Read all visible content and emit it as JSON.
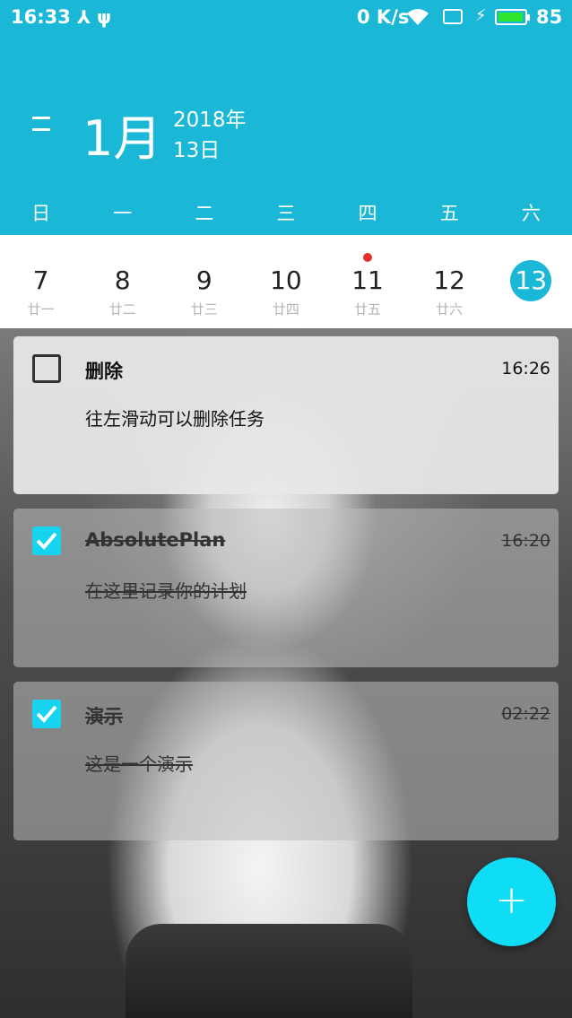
{
  "status_bar": {
    "time": "16:33",
    "left_icons": "⅄ ψ",
    "net_speed": "0 K/s",
    "battery_percent": "85",
    "battery_level": 0.85
  },
  "header": {
    "month": "1月",
    "year": "2018年",
    "day": "13日",
    "color": "#1ab8d6"
  },
  "weekdays": [
    "日",
    "一",
    "二",
    "三",
    "四",
    "五",
    "六"
  ],
  "dates": [
    {
      "num": "7",
      "lunar": "廿一"
    },
    {
      "num": "8",
      "lunar": "廿二"
    },
    {
      "num": "9",
      "lunar": "廿三"
    },
    {
      "num": "10",
      "lunar": "廿四"
    },
    {
      "num": "11",
      "lunar": "廿五"
    },
    {
      "num": "12",
      "lunar": "廿六"
    },
    {
      "num": "13",
      "lunar": ""
    }
  ],
  "tasks": [
    {
      "title": "删除",
      "time": "16:26",
      "desc": "往左滑动可以删除任务",
      "done": false
    },
    {
      "title": "AbsolutePlan",
      "time": "16:20",
      "desc": "在这里记录你的计划",
      "done": true
    },
    {
      "title": "演示",
      "time": "02:22",
      "desc": "这是一个演示",
      "done": true
    }
  ],
  "fab": {
    "label": "+",
    "color": "#0fdcf5"
  },
  "icons": {
    "menu": "menu-icon",
    "wifi": "wifi-icon",
    "battery": "battery-icon",
    "check": "check-icon",
    "event_dot": "event-dot"
  }
}
